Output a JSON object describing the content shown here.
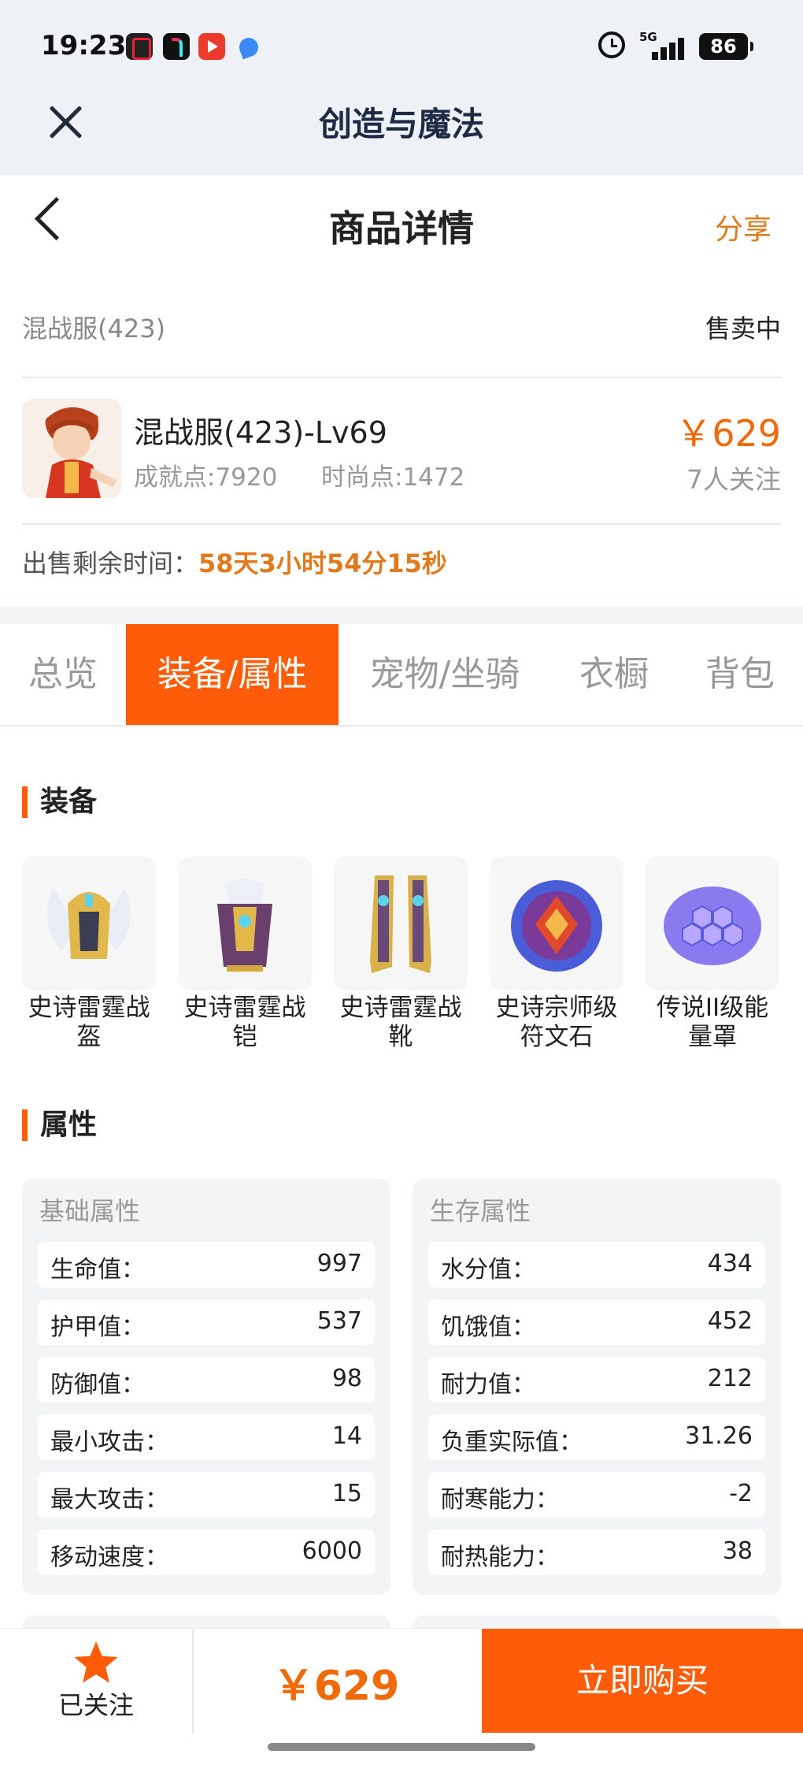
{
  "status_bar": {
    "time": "19:23",
    "network": "5G",
    "battery": "86"
  },
  "app_bar": {
    "title": "创造与魔法"
  },
  "header": {
    "title": "商品详情",
    "share_label": "分享"
  },
  "listing": {
    "server": "混战服(423)",
    "status": "售卖中",
    "name": "混战服(423)-Lv69",
    "achievement": "成就点:7920",
    "fashion": "时尚点:1472",
    "price": "￥629",
    "followers": "7人关注",
    "remaining_label": "出售剩余时间：",
    "remaining_value": "58天3小时54分15秒"
  },
  "tabs": [
    {
      "label": "总览",
      "active": false
    },
    {
      "label": "装备/属性",
      "active": true
    },
    {
      "label": "宠物/坐骑",
      "active": false
    },
    {
      "label": "衣橱",
      "active": false
    },
    {
      "label": "背包",
      "active": false
    }
  ],
  "equipment": {
    "title": "装备",
    "items": [
      {
        "name": "史诗雷霆战盔",
        "icon": "helmet-icon"
      },
      {
        "name": "史诗雷霆战铠",
        "icon": "armor-icon"
      },
      {
        "name": "史诗雷霆战靴",
        "icon": "boots-icon"
      },
      {
        "name": "史诗宗师级符文石",
        "icon": "rune-stone-icon"
      },
      {
        "name": "传说II级能量罩",
        "icon": "energy-shield-icon"
      }
    ]
  },
  "attributes": {
    "title": "属性",
    "basic": {
      "title": "基础属性",
      "rows": [
        {
          "key": "生命值：",
          "value": "997"
        },
        {
          "key": "护甲值：",
          "value": "537"
        },
        {
          "key": "防御值：",
          "value": "98"
        },
        {
          "key": "最小攻击：",
          "value": "14"
        },
        {
          "key": "最大攻击：",
          "value": "15"
        },
        {
          "key": "移动速度：",
          "value": "6000"
        }
      ]
    },
    "survival": {
      "title": "生存属性",
      "rows": [
        {
          "key": "水分值：",
          "value": "434"
        },
        {
          "key": "饥饿值：",
          "value": "452"
        },
        {
          "key": "耐力值：",
          "value": "212"
        },
        {
          "key": "负重实际值：",
          "value": "31.26"
        },
        {
          "key": "耐寒能力：",
          "value": "-2"
        },
        {
          "key": "耐热能力：",
          "value": "38"
        }
      ]
    }
  },
  "bottom_bar": {
    "follow_label": "已关注",
    "price": "￥629",
    "buy_label": "立即购买"
  },
  "colors": {
    "accent": "#ff5c0a",
    "price": "#f06a0a",
    "highlight": "#e07a1c"
  }
}
